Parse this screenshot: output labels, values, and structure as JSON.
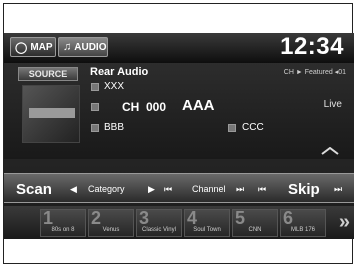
{
  "header": {
    "tabs": [
      {
        "label": "MAP",
        "icon": "map-icon"
      },
      {
        "label": "AUDIO",
        "icon": "music-note-icon"
      }
    ],
    "clock": "12:34"
  },
  "now_playing": {
    "source_label": "SOURCE",
    "title": "Rear Audio",
    "line1": "XXX",
    "channel_prefix": "CH",
    "channel_number": "000",
    "channel_name": "AAA",
    "line3_left": "BBB",
    "line3_right": "CCC",
    "featured": "CH  ►  Featured  ◂01",
    "live": "Live"
  },
  "controls": {
    "scan": "Scan",
    "category": "Category",
    "channel": "Channel",
    "skip": "Skip"
  },
  "presets": [
    {
      "number": "1",
      "name": "80s on 8"
    },
    {
      "number": "2",
      "name": "Venus"
    },
    {
      "number": "3",
      "name": "Classic Vinyl"
    },
    {
      "number": "4",
      "name": "Soul Town"
    },
    {
      "number": "5",
      "name": "CNN"
    },
    {
      "number": "6",
      "name": "MLB 176"
    }
  ]
}
